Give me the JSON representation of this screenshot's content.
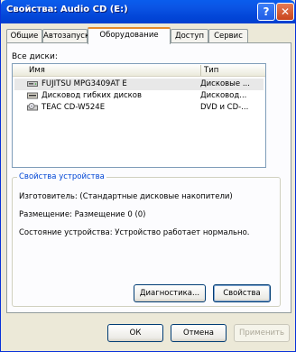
{
  "window": {
    "title": "Свойства: Audio CD (E:)",
    "help_glyph": "?",
    "close_glyph": "✕"
  },
  "tabs": [
    {
      "label": "Общие",
      "active": false
    },
    {
      "label": "Автозапуск",
      "active": false
    },
    {
      "label": "Оборудование",
      "active": true
    },
    {
      "label": "Доступ",
      "active": false
    },
    {
      "label": "Сервис",
      "active": false
    }
  ],
  "hardware": {
    "disks_label": "Все диски:",
    "columns": {
      "name": "Имя",
      "type": "Тип"
    },
    "devices": [
      {
        "name": "FUJITSU MPG3409AT E",
        "type": "Дисковые ...",
        "icon": "hard-disk-icon"
      },
      {
        "name": "Дисковод гибких дисков",
        "type": "Дисковод...",
        "icon": "floppy-drive-icon"
      },
      {
        "name": "TEAC CD-W524E",
        "type": "DVD и CD-...",
        "icon": "cd-drive-icon"
      }
    ]
  },
  "device_properties": {
    "title": "Свойства устройства",
    "manufacturer": "Изготовитель: (Стандартные дисковые накопители)",
    "location": "Размещение: Размещение 0 (0)",
    "status": "Состояние устройства: Устройство работает нормально."
  },
  "buttons": {
    "diagnostics": "Диагностика...",
    "properties": "Свойства",
    "ok": "ОК",
    "cancel": "Отмена",
    "apply": "Применить"
  }
}
